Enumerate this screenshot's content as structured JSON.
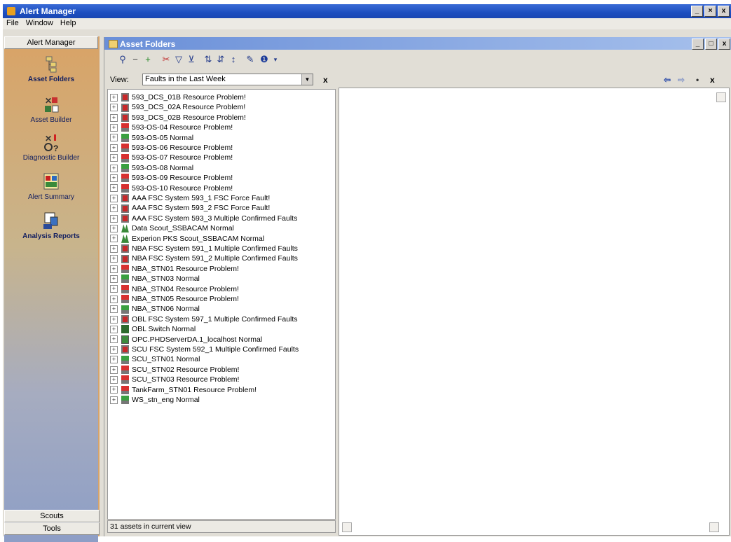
{
  "app": {
    "title": "Alert Manager",
    "window_buttons": [
      "_",
      "×",
      "x"
    ]
  },
  "menu": [
    "File",
    "Window",
    "Help"
  ],
  "sidebar": {
    "header": "Alert Manager",
    "items": [
      {
        "label": "Asset Folders",
        "icon": "asset-folders-icon"
      },
      {
        "label": "Asset Builder",
        "icon": "asset-builder-icon"
      },
      {
        "label": "Diagnostic Builder",
        "icon": "diagnostic-builder-icon"
      },
      {
        "label": "Alert Summary",
        "icon": "alert-summary-icon"
      },
      {
        "label": "Analysis Reports",
        "icon": "analysis-reports-icon"
      }
    ],
    "bottom": [
      "Scouts",
      "Tools"
    ]
  },
  "child": {
    "title": "Asset Folders",
    "window_buttons": [
      "_",
      "□",
      "x"
    ]
  },
  "view": {
    "label": "View:",
    "selected": "Faults in the Last Week",
    "close": "x"
  },
  "tree_items": [
    {
      "label": "593_DCS_01B Resource Problem!",
      "type": "fsc"
    },
    {
      "label": "593_DCS_02A Resource Problem!",
      "type": "fsc"
    },
    {
      "label": "593_DCS_02B Resource Problem!",
      "type": "fsc"
    },
    {
      "label": "593-OS-04 Resource Problem!",
      "type": "red"
    },
    {
      "label": "593-OS-05 Normal",
      "type": "green"
    },
    {
      "label": "593-OS-06 Resource Problem!",
      "type": "red"
    },
    {
      "label": "593-OS-07 Resource Problem!",
      "type": "red"
    },
    {
      "label": "593-OS-08 Normal",
      "type": "green"
    },
    {
      "label": "593-OS-09 Resource Problem!",
      "type": "red"
    },
    {
      "label": "593-OS-10 Resource Problem!",
      "type": "red"
    },
    {
      "label": "AAA FSC System 593_1 FSC Force Fault!",
      "type": "fsc"
    },
    {
      "label": "AAA FSC System 593_2 FSC Force Fault!",
      "type": "fsc"
    },
    {
      "label": "AAA FSC System 593_3 Multiple Confirmed Faults",
      "type": "fsc"
    },
    {
      "label": "Data Scout_SSBACAM Normal",
      "type": "scout"
    },
    {
      "label": "Experion PKS Scout_SSBACAM Normal",
      "type": "scout"
    },
    {
      "label": "NBA FSC System 591_1 Multiple Confirmed Faults",
      "type": "fsc"
    },
    {
      "label": "NBA FSC System 591_2 Multiple Confirmed Faults",
      "type": "fsc"
    },
    {
      "label": "NBA_STN01 Resource Problem!",
      "type": "red"
    },
    {
      "label": "NBA_STN03 Normal",
      "type": "green"
    },
    {
      "label": "NBA_STN04 Resource Problem!",
      "type": "red"
    },
    {
      "label": "NBA_STN05 Resource Problem!",
      "type": "red"
    },
    {
      "label": "NBA_STN06 Normal",
      "type": "green"
    },
    {
      "label": "OBL FSC System 597_1 Multiple Confirmed Faults",
      "type": "fsc"
    },
    {
      "label": "OBL Switch Normal",
      "type": "switch"
    },
    {
      "label": "OPC.PHDServerDA.1_localhost Normal",
      "type": "opc"
    },
    {
      "label": "SCU FSC System 592_1 Multiple Confirmed Faults",
      "type": "fsc"
    },
    {
      "label": "SCU_STN01 Normal",
      "type": "green"
    },
    {
      "label": "SCU_STN02 Resource Problem!",
      "type": "red"
    },
    {
      "label": "SCU_STN03 Resource Problem!",
      "type": "red"
    },
    {
      "label": "TankFarm_STN01 Resource Problem!",
      "type": "red"
    },
    {
      "label": "WS_stn_eng Normal",
      "type": "green"
    }
  ],
  "status": "31 assets in current view",
  "right_panel": {
    "nav": [
      "⇦",
      "⇨",
      "•",
      "x"
    ]
  }
}
